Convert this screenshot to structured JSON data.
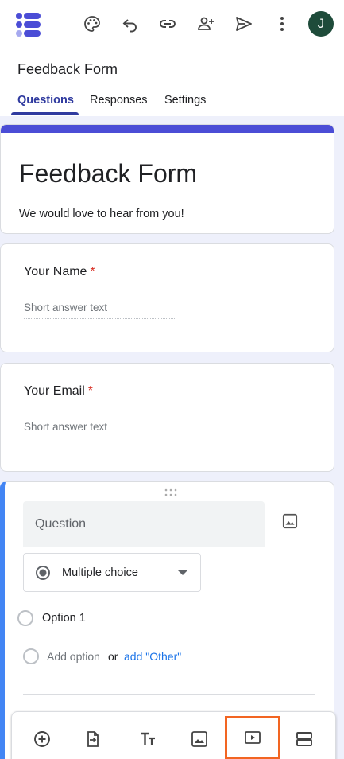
{
  "header": {
    "doc_title": "Feedback Form",
    "avatar_initial": "J",
    "icons": [
      "palette-icon",
      "undo-icon",
      "link-icon",
      "add-collaborator-icon",
      "send-icon",
      "more-vert-icon"
    ]
  },
  "tabs": [
    {
      "label": "Questions",
      "active": true
    },
    {
      "label": "Responses",
      "active": false
    },
    {
      "label": "Settings",
      "active": false
    }
  ],
  "form": {
    "title": "Feedback Form",
    "description": "We would love to hear from you!"
  },
  "questions": [
    {
      "label": "Your Name",
      "required_mark": "*",
      "placeholder": "Short answer text"
    },
    {
      "label": "Your Email",
      "required_mark": "*",
      "placeholder": "Short answer text"
    }
  ],
  "editor": {
    "question_placeholder": "Question",
    "type_label": "Multiple choice",
    "options": [
      "Option 1"
    ],
    "add_option": "Add option",
    "or_text": "or",
    "add_other": "add \"Other\""
  },
  "toolbar": {
    "items": [
      "add-question-icon",
      "import-questions-icon",
      "add-title-icon",
      "add-image-icon",
      "add-video-icon",
      "add-section-icon"
    ],
    "highlighted": "add-video-icon"
  },
  "colors": {
    "accent": "#4b4dd6",
    "tab_active": "#2f3a9f",
    "edit_border": "#4285f4",
    "required": "#d93025",
    "link": "#1a73e8",
    "highlight": "#f26522",
    "canvas_bg": "#eef0fb"
  }
}
